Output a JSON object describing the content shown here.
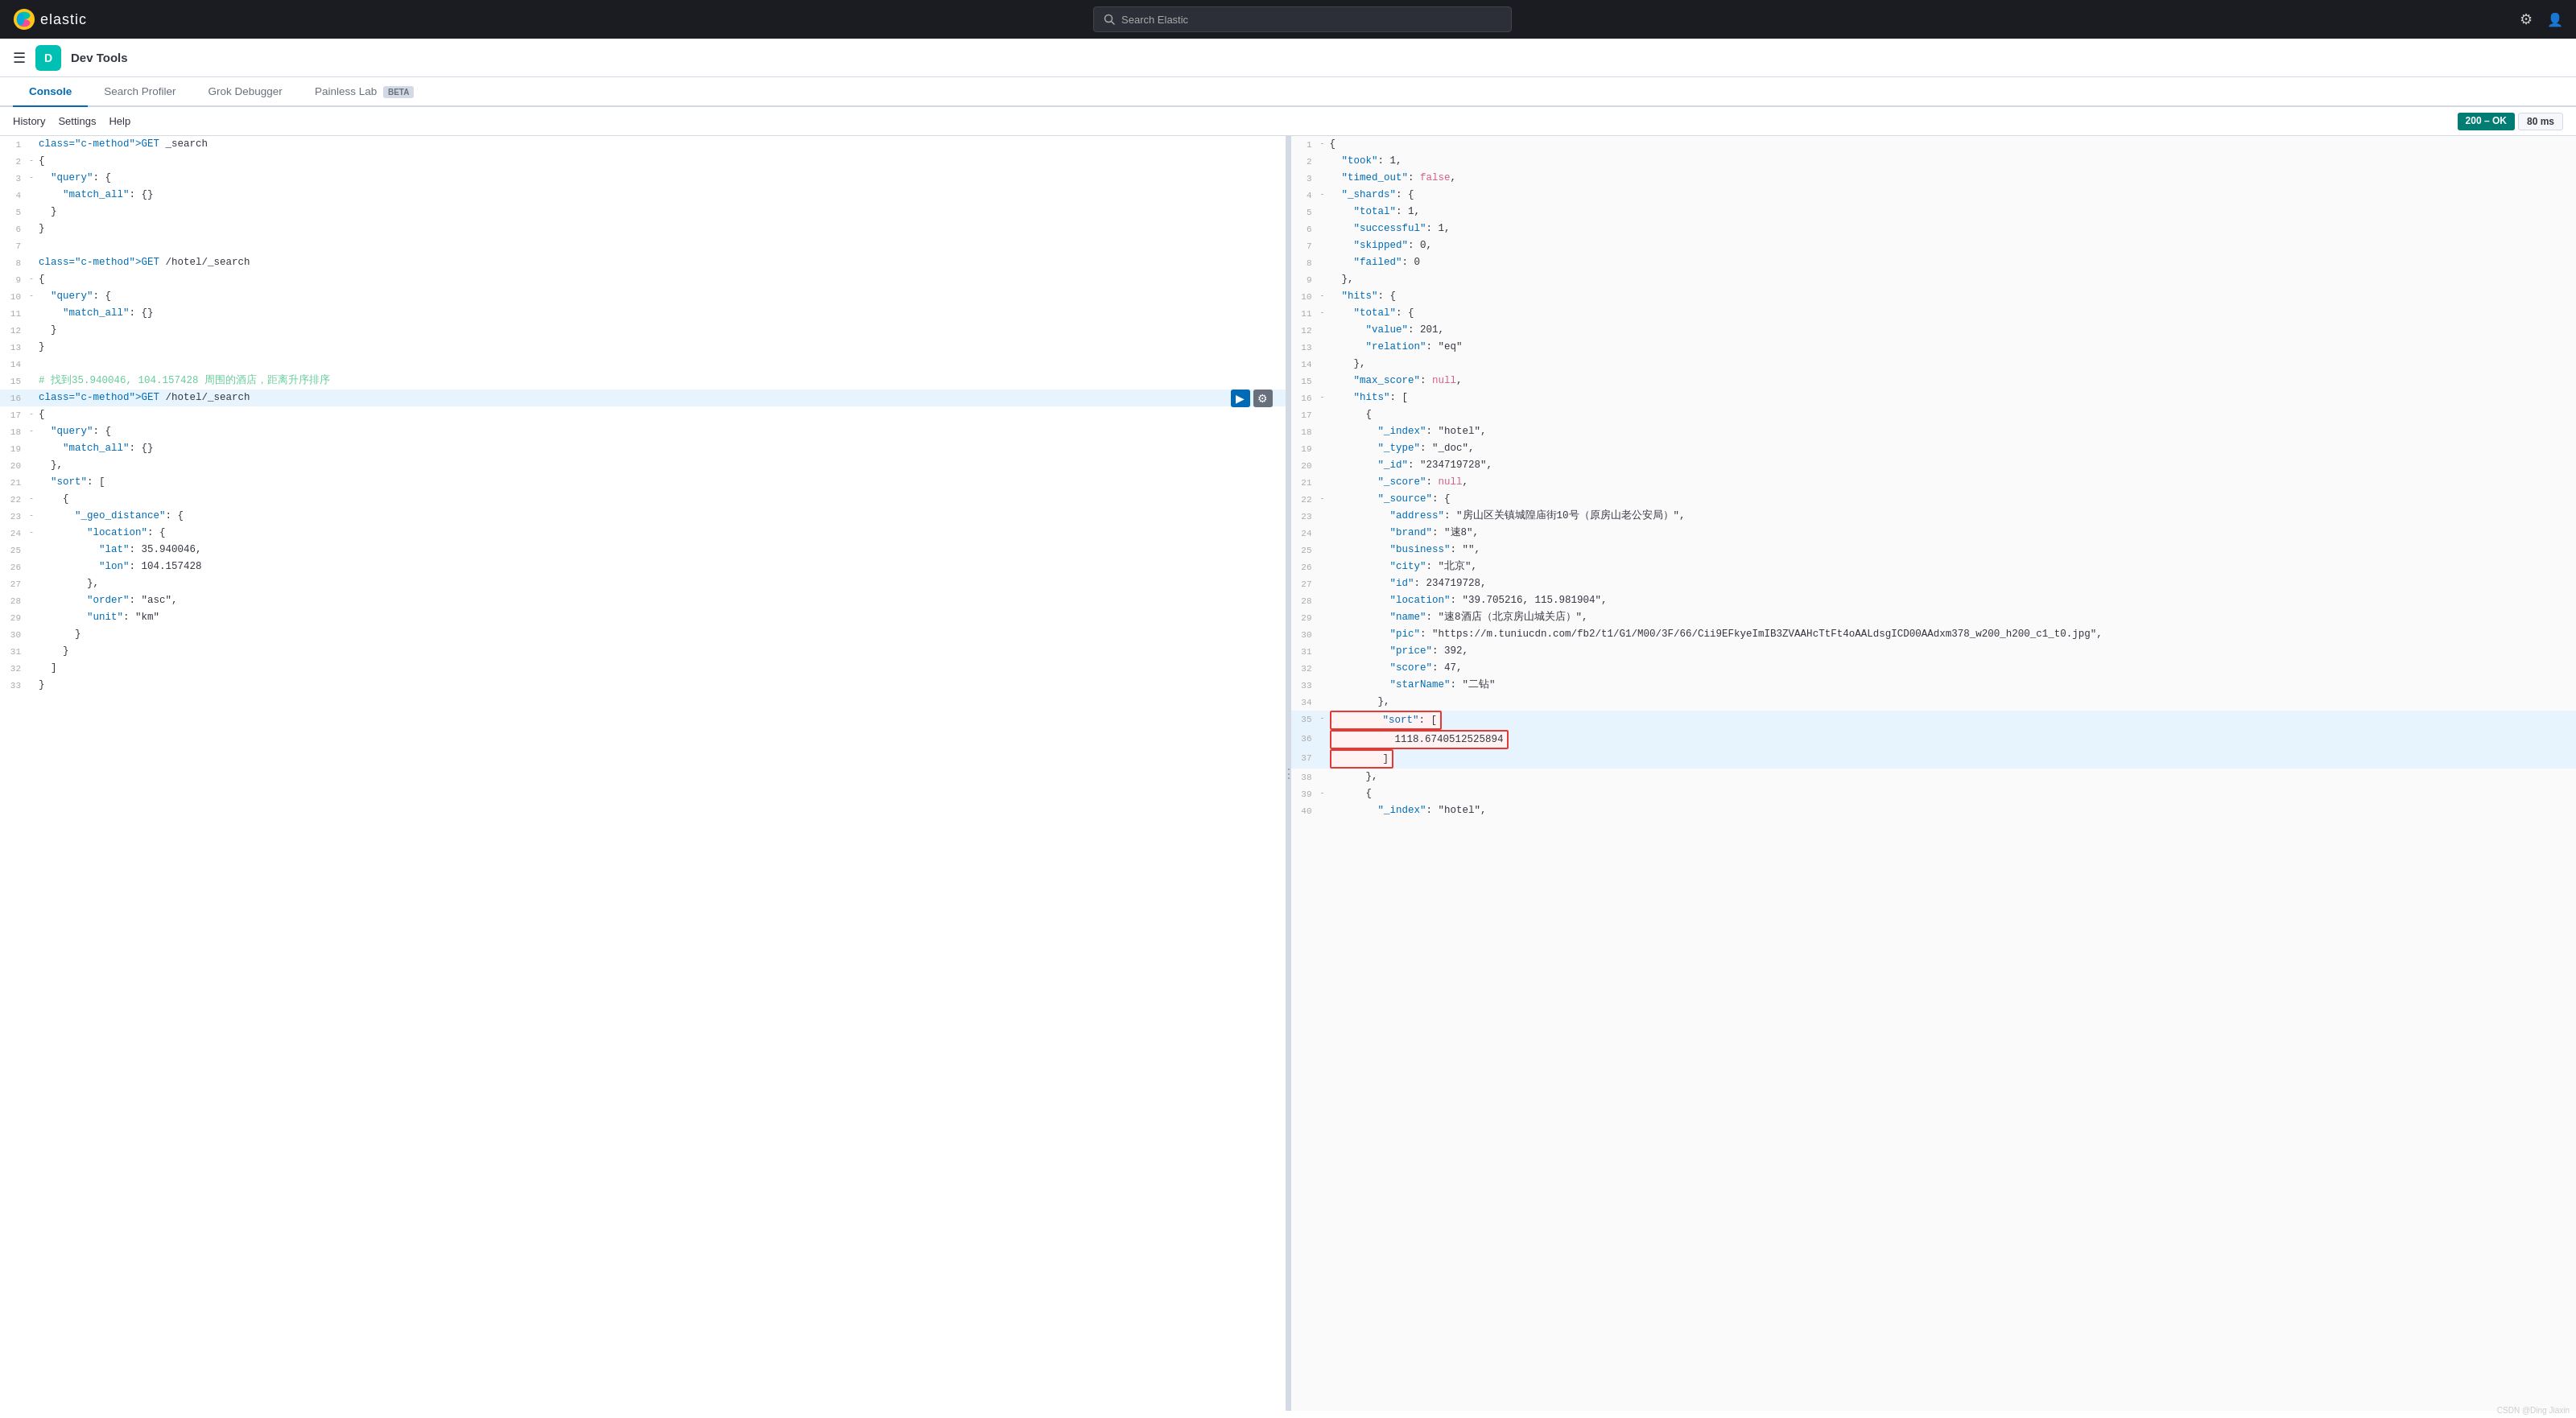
{
  "topNav": {
    "logo": "elastic",
    "searchPlaceholder": "Search Elastic",
    "icons": [
      "gear-icon",
      "user-icon"
    ]
  },
  "secondNav": {
    "appBadge": "D",
    "appTitle": "Dev Tools"
  },
  "tabs": [
    {
      "label": "Console",
      "active": true
    },
    {
      "label": "Search Profiler",
      "active": false
    },
    {
      "label": "Grok Debugger",
      "active": false
    },
    {
      "label": "Painless Lab",
      "active": false,
      "beta": true
    }
  ],
  "toolbar": {
    "history": "History",
    "settings": "Settings",
    "help": "Help",
    "statusOk": "200 – OK",
    "statusMs": "80 ms"
  },
  "leftEditor": {
    "lines": [
      {
        "num": 1,
        "fold": "",
        "content": "GET _search",
        "type": "request"
      },
      {
        "num": 2,
        "fold": "-",
        "content": "{",
        "type": "brace"
      },
      {
        "num": 3,
        "fold": "-",
        "content": "  \"query\": {",
        "type": "json"
      },
      {
        "num": 4,
        "fold": "",
        "content": "    \"match_all\": {}",
        "type": "json"
      },
      {
        "num": 5,
        "fold": "",
        "content": "  }",
        "type": "json"
      },
      {
        "num": 6,
        "fold": "",
        "content": "}",
        "type": "brace"
      },
      {
        "num": 7,
        "fold": "",
        "content": "",
        "type": "empty"
      },
      {
        "num": 8,
        "fold": "",
        "content": "GET /hotel/_search",
        "type": "request"
      },
      {
        "num": 9,
        "fold": "-",
        "content": "{",
        "type": "brace"
      },
      {
        "num": 10,
        "fold": "-",
        "content": "  \"query\": {",
        "type": "json"
      },
      {
        "num": 11,
        "fold": "",
        "content": "    \"match_all\": {}",
        "type": "json"
      },
      {
        "num": 12,
        "fold": "",
        "content": "  }",
        "type": "json"
      },
      {
        "num": 13,
        "fold": "",
        "content": "}",
        "type": "brace"
      },
      {
        "num": 14,
        "fold": "",
        "content": "",
        "type": "empty"
      },
      {
        "num": 15,
        "fold": "",
        "content": "# 找到35.940046, 104.157428 周围的酒店，距离升序排序",
        "type": "comment"
      },
      {
        "num": 16,
        "fold": "",
        "content": "GET /hotel/_search",
        "type": "request",
        "highlighted": true,
        "showActions": true
      },
      {
        "num": 17,
        "fold": "-",
        "content": "{",
        "type": "brace"
      },
      {
        "num": 18,
        "fold": "-",
        "content": "  \"query\": {",
        "type": "json"
      },
      {
        "num": 19,
        "fold": "",
        "content": "    \"match_all\": {}",
        "type": "json"
      },
      {
        "num": 20,
        "fold": "",
        "content": "  },",
        "type": "json"
      },
      {
        "num": 21,
        "fold": "",
        "content": "  \"sort\": [",
        "type": "json"
      },
      {
        "num": 22,
        "fold": "-",
        "content": "    {",
        "type": "brace"
      },
      {
        "num": 23,
        "fold": "-",
        "content": "      \"_geo_distance\": {",
        "type": "json"
      },
      {
        "num": 24,
        "fold": "-",
        "content": "        \"location\": {",
        "type": "json"
      },
      {
        "num": 25,
        "fold": "",
        "content": "          \"lat\": 35.940046,",
        "type": "json"
      },
      {
        "num": 26,
        "fold": "",
        "content": "          \"lon\": 104.157428",
        "type": "json"
      },
      {
        "num": 27,
        "fold": "",
        "content": "        },",
        "type": "json"
      },
      {
        "num": 28,
        "fold": "",
        "content": "        \"order\": \"asc\",",
        "type": "json"
      },
      {
        "num": 29,
        "fold": "",
        "content": "        \"unit\": \"km\"",
        "type": "json"
      },
      {
        "num": 30,
        "fold": "",
        "content": "      }",
        "type": "json"
      },
      {
        "num": 31,
        "fold": "",
        "content": "    }",
        "type": "brace"
      },
      {
        "num": 32,
        "fold": "",
        "content": "  ]",
        "type": "json"
      },
      {
        "num": 33,
        "fold": "",
        "content": "}",
        "type": "brace"
      }
    ]
  },
  "rightPanel": {
    "lines": [
      {
        "num": 1,
        "fold": "-",
        "content": "{"
      },
      {
        "num": 2,
        "fold": "",
        "content": "  \"took\" : 1,"
      },
      {
        "num": 3,
        "fold": "",
        "content": "  \"timed_out\" : false,"
      },
      {
        "num": 4,
        "fold": "-",
        "content": "  \"_shards\" : {"
      },
      {
        "num": 5,
        "fold": "",
        "content": "    \"total\" : 1,"
      },
      {
        "num": 6,
        "fold": "",
        "content": "    \"successful\" : 1,"
      },
      {
        "num": 7,
        "fold": "",
        "content": "    \"skipped\" : 0,"
      },
      {
        "num": 8,
        "fold": "",
        "content": "    \"failed\" : 0"
      },
      {
        "num": 9,
        "fold": "",
        "content": "  },"
      },
      {
        "num": 10,
        "fold": "-",
        "content": "  \"hits\" : {"
      },
      {
        "num": 11,
        "fold": "-",
        "content": "    \"total\" : {"
      },
      {
        "num": 12,
        "fold": "",
        "content": "      \"value\" : 201,"
      },
      {
        "num": 13,
        "fold": "",
        "content": "      \"relation\" : \"eq\""
      },
      {
        "num": 14,
        "fold": "",
        "content": "    },"
      },
      {
        "num": 15,
        "fold": "",
        "content": "    \"max_score\" : null,"
      },
      {
        "num": 16,
        "fold": "-",
        "content": "    \"hits\" : ["
      },
      {
        "num": 17,
        "fold": "",
        "content": "      {"
      },
      {
        "num": 18,
        "fold": "",
        "content": "        \"_index\" : \"hotel\","
      },
      {
        "num": 19,
        "fold": "",
        "content": "        \"_type\" : \"_doc\","
      },
      {
        "num": 20,
        "fold": "",
        "content": "        \"_id\" : \"234719728\","
      },
      {
        "num": 21,
        "fold": "",
        "content": "        \"_score\" : null,"
      },
      {
        "num": 22,
        "fold": "-",
        "content": "        \"_source\" : {"
      },
      {
        "num": 23,
        "fold": "",
        "content": "          \"address\" : \"房山区关镇城隍庙街10号（原房山老公安局）\","
      },
      {
        "num": 24,
        "fold": "",
        "content": "          \"brand\" : \"速8\","
      },
      {
        "num": 25,
        "fold": "",
        "content": "          \"business\" : \"\","
      },
      {
        "num": 26,
        "fold": "",
        "content": "          \"city\" : \"北京\","
      },
      {
        "num": 27,
        "fold": "",
        "content": "          \"id\" : 234719728,"
      },
      {
        "num": 28,
        "fold": "",
        "content": "          \"location\" : \"39.705216, 115.981904\","
      },
      {
        "num": 29,
        "fold": "",
        "content": "          \"name\" : \"速8酒店（北京房山城关店）\","
      },
      {
        "num": 30,
        "fold": "",
        "content": "          \"pic\" : \"https://m.tuniucdn.com/fb2/t1/G1/M00/3F/66/Cii9EFkyeImIB3ZVAAHcTtFt4oAALdsgICD00AAdxm378_w200_h200_c1_t0.jpg\","
      },
      {
        "num": 31,
        "fold": "",
        "content": "          \"price\" : 392,"
      },
      {
        "num": 32,
        "fold": "",
        "content": "          \"score\" : 47,"
      },
      {
        "num": 33,
        "fold": "",
        "content": "          \"starName\" : \"二钻\""
      },
      {
        "num": 34,
        "fold": "",
        "content": "        },"
      },
      {
        "num": 35,
        "fold": "-",
        "content": "        \"sort\" : [",
        "highlighted": true
      },
      {
        "num": 36,
        "fold": "",
        "content": "          1118.6740512525894",
        "highlighted": true
      },
      {
        "num": 37,
        "fold": "",
        "content": "        ]",
        "highlighted": true
      },
      {
        "num": 38,
        "fold": "",
        "content": "      },"
      },
      {
        "num": 39,
        "fold": "-",
        "content": "      {"
      },
      {
        "num": 40,
        "fold": "",
        "content": "        \"_index\" : \"hotel\","
      }
    ]
  },
  "watermark": "CSDN @Ding Jiaxin"
}
